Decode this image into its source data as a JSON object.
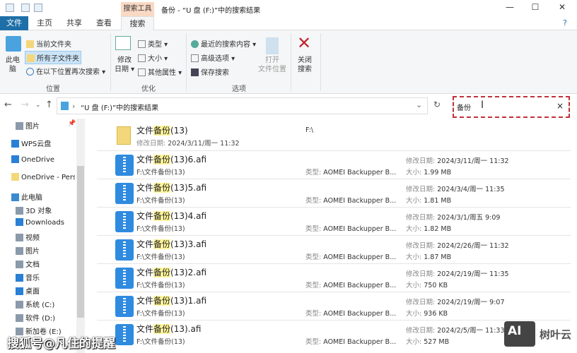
{
  "window": {
    "context_tab": "搜索工具",
    "title": "备份 - “U 盘 (F:)”中的搜索结果",
    "minimize": "—",
    "maximize": "☐",
    "close": "✕"
  },
  "tabs": {
    "file": "文件",
    "home": "主页",
    "share": "共享",
    "view": "查看",
    "search": "搜索"
  },
  "ribbon": {
    "this_pc": "此电\n脑",
    "current_folder": "当前文件夹",
    "all_subfolders": "所有子文件夹",
    "search_again": "在以下位置再次搜索 ▾",
    "location_group": "位置",
    "date_modified": "修改\n日期 ▾",
    "kind": "类型 ▾",
    "size": "大小 ▾",
    "other_props": "其他属性 ▾",
    "refine_group": "优化",
    "recent_searches": "最近的搜索内容 ▾",
    "advanced": "高级选项 ▾",
    "save_search": "保存搜索",
    "open_location": "打开\n文件位置",
    "options_group": "选项",
    "close_search": "关闭\n搜索"
  },
  "address": {
    "path": "“U 盘 (F:)”中的搜索结果",
    "search_value": "备份",
    "clear": "×",
    "refresh": "↻",
    "dropdown": "⌄"
  },
  "nav": [
    {
      "label": "图片",
      "icon": "pictures-icon"
    },
    {
      "label": "WPS云盘",
      "icon": "cloud-icon"
    },
    {
      "label": "OneDrive",
      "icon": "onedrive-icon"
    },
    {
      "label": "OneDrive - Perso",
      "icon": "folder-icon"
    },
    {
      "label": "此电脑",
      "icon": "computer-icon"
    },
    {
      "label": "3D 对象",
      "icon": "3d-icon"
    },
    {
      "label": "Downloads",
      "icon": "download-icon"
    },
    {
      "label": "视频",
      "icon": "video-icon"
    },
    {
      "label": "图片",
      "icon": "pictures-icon"
    },
    {
      "label": "文档",
      "icon": "document-icon"
    },
    {
      "label": "音乐",
      "icon": "music-icon"
    },
    {
      "label": "桌面",
      "icon": "desktop-icon"
    },
    {
      "label": "系统 (C:)",
      "icon": "drive-icon"
    },
    {
      "label": "软件 (D:)",
      "icon": "drive-icon"
    },
    {
      "label": "新加卷 (E:)",
      "icon": "drive-icon"
    }
  ],
  "folder": {
    "pre": "文件",
    "hl": "备份",
    "post": "(13)",
    "date_label": "修改日期:",
    "date": "2024/3/11/周一 11:32",
    "location": "F:\\"
  },
  "labels": {
    "type": "类型:",
    "date": "修改日期:",
    "size": "大小:"
  },
  "files": [
    {
      "pre": "文件",
      "hl": "备份",
      "post": "(13)6.afi",
      "path": "F:\\文件备份(13)",
      "type": "AOMEI Backupper B...",
      "date": "2024/3/11/周一 11:32",
      "size": "1.99 MB"
    },
    {
      "pre": "文件",
      "hl": "备份",
      "post": "(13)5.afi",
      "path": "F:\\文件备份(13)",
      "type": "AOMEI Backupper B...",
      "date": "2024/3/4/周一 11:35",
      "size": "1.81 MB"
    },
    {
      "pre": "文件",
      "hl": "备份",
      "post": "(13)4.afi",
      "path": "F:\\文件备份(13)",
      "type": "AOMEI Backupper B...",
      "date": "2024/3/1/周五 9:09",
      "size": "1.82 MB"
    },
    {
      "pre": "文件",
      "hl": "备份",
      "post": "(13)3.afi",
      "path": "F:\\文件备份(13)",
      "type": "AOMEI Backupper B...",
      "date": "2024/2/26/周一 11:32",
      "size": "1.87 MB"
    },
    {
      "pre": "文件",
      "hl": "备份",
      "post": "(13)2.afi",
      "path": "F:\\文件备份(13)",
      "type": "AOMEI Backupper B...",
      "date": "2024/2/19/周一 11:35",
      "size": "750 KB"
    },
    {
      "pre": "文件",
      "hl": "备份",
      "post": "(13)1.afi",
      "path": "F:\\文件备份(13)",
      "type": "AOMEI Backupper B...",
      "date": "2024/2/19/周一 9:07",
      "size": "936 KB"
    },
    {
      "pre": "文件",
      "hl": "备份",
      "post": "(13).afi",
      "path": "F:\\文件备份(13)",
      "type": "AOMEI Backupper B...",
      "date": "2024/2/5/周一 11:33",
      "size": "527 MB"
    }
  ],
  "watermark": {
    "left": "搜狐号@凡住的提醒",
    "right_logo": "AI",
    "right_text": "树叶云"
  }
}
